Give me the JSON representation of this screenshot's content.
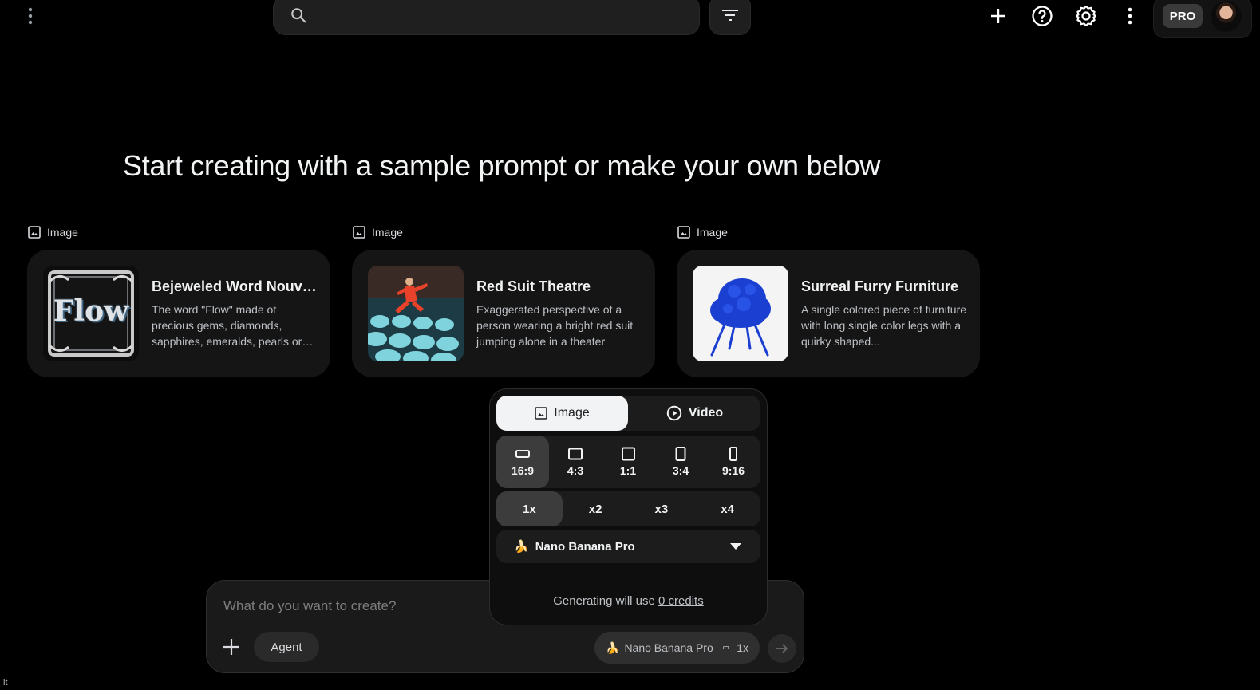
{
  "header": {
    "search": {
      "placeholder": "",
      "value": ""
    },
    "pro_label": "PRO"
  },
  "main": {
    "heading": "Start creating with a sample prompt or make your own below",
    "cards": [
      {
        "type_label": "Image",
        "title": "Bejeweled Word Nouveau",
        "description": "The word \"Flow\" made of precious gems, diamonds, sapphires, emeralds, pearls or other stones"
      },
      {
        "type_label": "Image",
        "title": "Red Suit Theatre",
        "description": "Exaggerated perspective of a person wearing a bright red suit jumping alone in a theater"
      },
      {
        "type_label": "Image",
        "title": "Surreal Furry Furniture",
        "description": "A single colored piece of furniture with long single color legs with a quirky shaped..."
      }
    ],
    "thumbnail_text": "Flow"
  },
  "settings_popup": {
    "modes": [
      {
        "label": "Image",
        "icon": "image-icon",
        "selected": true
      },
      {
        "label": "Video",
        "icon": "play-circle-icon",
        "selected": false
      }
    ],
    "aspect_ratios": [
      {
        "label": "16:9",
        "selected": true
      },
      {
        "label": "4:3",
        "selected": false
      },
      {
        "label": "1:1",
        "selected": false
      },
      {
        "label": "3:4",
        "selected": false
      },
      {
        "label": "9:16",
        "selected": false
      }
    ],
    "counts": [
      {
        "label": "1x",
        "selected": true
      },
      {
        "label": "x2",
        "selected": false
      },
      {
        "label": "x3",
        "selected": false
      },
      {
        "label": "x4",
        "selected": false
      }
    ],
    "model": {
      "emoji": "🍌",
      "label": "Nano Banana Pro"
    },
    "credits_prefix": "Generating will use",
    "credits_link": "0 credits"
  },
  "prompt": {
    "placeholder": "What do you want to create?",
    "value": "",
    "agent_label": "Agent",
    "chip_emoji": "🍌",
    "chip_model": "Nano Banana Pro",
    "chip_count": "1x"
  },
  "corner_text": "it",
  "colors": {
    "background": "#000000",
    "surface": "#151515",
    "popup": "#0e0e0e",
    "selected": "#3c3c3c",
    "text": "#f1f3f4",
    "muted": "#bdc1c6"
  }
}
